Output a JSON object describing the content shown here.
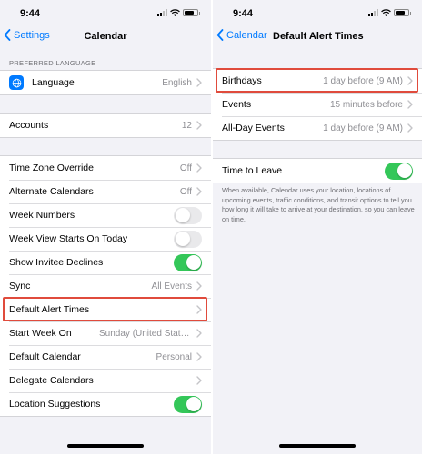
{
  "status_bar": {
    "time": "9:44"
  },
  "left": {
    "nav": {
      "back_label": "Settings",
      "title": "Calendar"
    },
    "section_header": "PREFERRED LANGUAGE",
    "language_row": {
      "label": "Language",
      "value": "English"
    },
    "accounts_row": {
      "label": "Accounts",
      "value": "12"
    },
    "rows": [
      {
        "label": "Time Zone Override",
        "value": "Off"
      },
      {
        "label": "Alternate Calendars",
        "value": "Off"
      },
      {
        "label": "Week Numbers",
        "toggle": "off"
      },
      {
        "label": "Week View Starts On Today",
        "toggle": "off"
      },
      {
        "label": "Show Invitee Declines",
        "toggle": "on"
      },
      {
        "label": "Sync",
        "value": "All Events"
      },
      {
        "label": "Default Alert Times",
        "value": ""
      },
      {
        "label": "Start Week On",
        "value": "Sunday (United States default)"
      },
      {
        "label": "Default Calendar",
        "value": "Personal"
      },
      {
        "label": "Delegate Calendars",
        "value": ""
      },
      {
        "label": "Location Suggestions",
        "toggle": "on"
      }
    ]
  },
  "right": {
    "nav": {
      "back_label": "Calendar",
      "title": "Default Alert Times"
    },
    "rows": [
      {
        "label": "Birthdays",
        "value": "1 day before (9 AM)"
      },
      {
        "label": "Events",
        "value": "15 minutes before"
      },
      {
        "label": "All-Day Events",
        "value": "1 day before (9 AM)"
      }
    ],
    "time_to_leave": {
      "label": "Time to Leave",
      "toggle": "on"
    },
    "footer": "When available, Calendar uses your location, locations of upcoming events, traffic conditions, and transit options to tell you how long it will take to arrive at your destination, so you can leave on time."
  },
  "colors": {
    "accent": "#007aff",
    "toggle_on": "#34c759",
    "highlight": "#e04b3c",
    "background": "#f2f2f7"
  },
  "icons": [
    "chevron-left-icon",
    "chevron-right-icon",
    "globe-icon",
    "signal-icon",
    "wifi-icon",
    "battery-icon"
  ]
}
